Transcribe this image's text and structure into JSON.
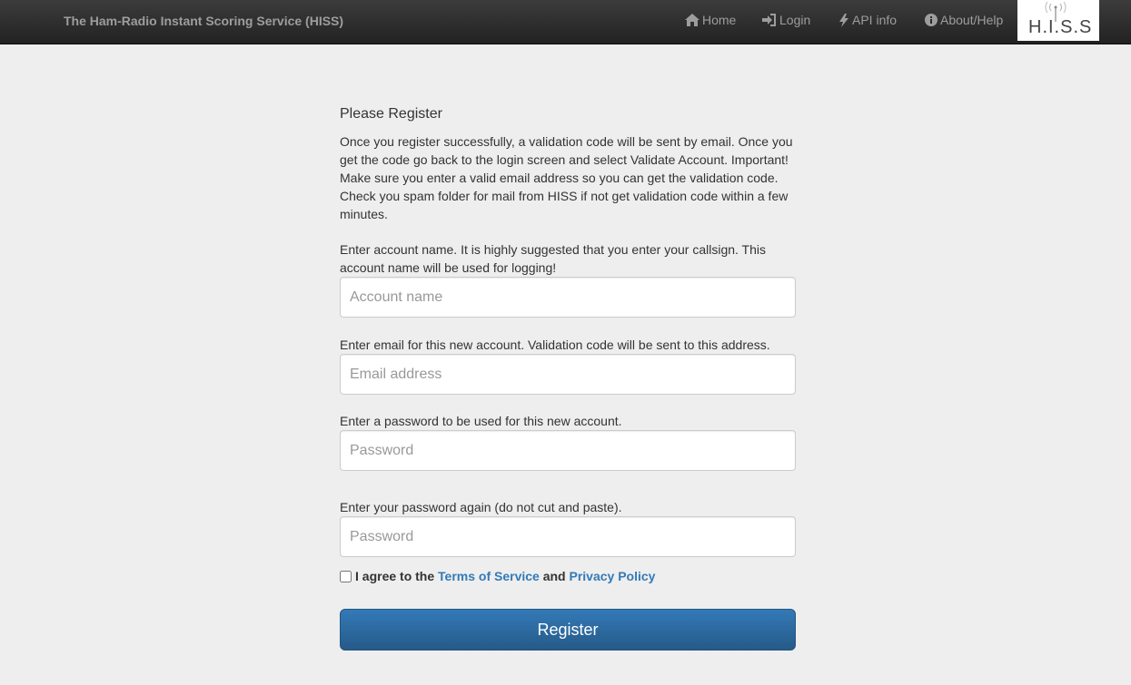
{
  "navbar": {
    "brand": "The Ham-Radio Instant Scoring Service (HISS)",
    "items": [
      {
        "label": "Home",
        "icon": "home-icon"
      },
      {
        "label": "Login",
        "icon": "login-icon"
      },
      {
        "label": "API info",
        "icon": "bolt-icon"
      },
      {
        "label": "About/Help",
        "icon": "info-icon"
      }
    ],
    "logo_text": "H.I.S.S"
  },
  "form": {
    "heading": "Please Register",
    "intro": "Once you register successfully, a validation code will be sent by email. Once you get the code go back to the login screen and select Validate Account. Important! Make sure you enter a valid email address so you can get the validation code. Check you spam folder for mail from HISS if not get validation code within a few minutes.",
    "account_label": "Enter account name. It is highly suggested that you enter your callsign. This account name will be used for logging!",
    "account_placeholder": "Account name",
    "account_value": "",
    "email_label": "Enter email for this new account. Validation code will be sent to this address.",
    "email_placeholder": "Email address",
    "email_value": "",
    "password_label": "Enter a password to be used for this new account.",
    "password_placeholder": "Password",
    "password_value": "",
    "password2_label": "Enter your password again (do not cut and paste).",
    "password2_placeholder": "Password",
    "password2_value": "",
    "agree_prefix": "I agree to the",
    "terms_link": "Terms of Service",
    "agree_and": "and",
    "privacy_link": "Privacy Policy",
    "agree_checked": false,
    "register_button": "Register"
  },
  "colors": {
    "navbar": "#222222",
    "nav_text": "#9d9d9d",
    "page_bg": "#eeeeee",
    "link": "#337ab7",
    "button": "#2d6ca2"
  }
}
